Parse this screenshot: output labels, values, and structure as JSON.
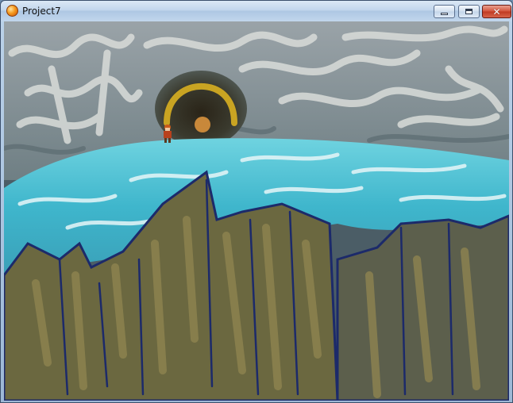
{
  "window": {
    "title": "Project7",
    "app_icon": "orange-orb-icon",
    "controls": [
      "minimize-icon",
      "maximize-icon",
      "close-icon"
    ]
  },
  "game_scene": {
    "environment": {
      "sky_cliff_color": "#8a96a0",
      "water_color": "#4fc4d6",
      "rock_color": "#6e6a40",
      "outline_color": "#1c2a6a"
    }
  }
}
